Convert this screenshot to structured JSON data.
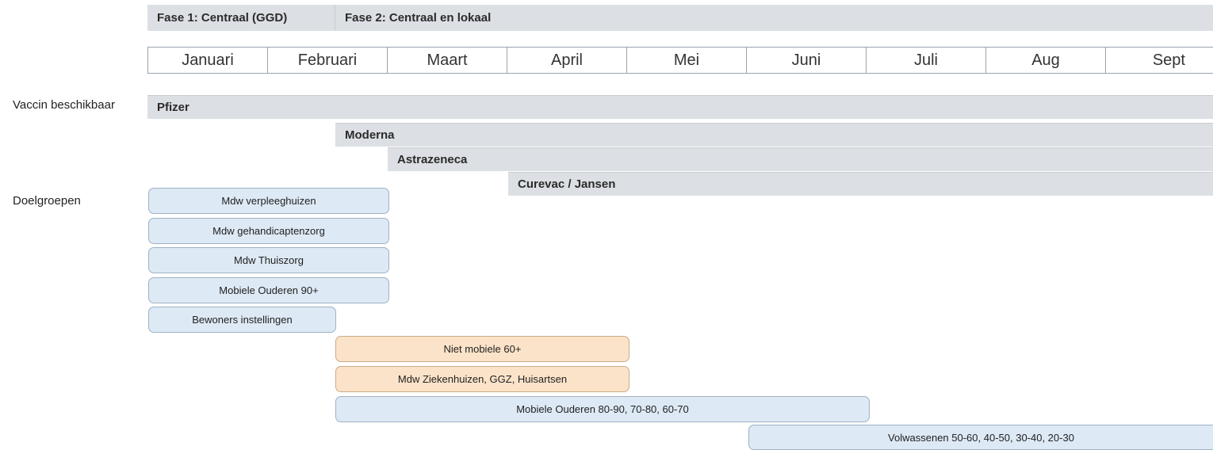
{
  "phases": [
    {
      "label": "Fase 1: Centraal (GGD)"
    },
    {
      "label": "Fase 2: Centraal en lokaal"
    }
  ],
  "months": [
    "Januari",
    "Februari",
    "Maart",
    "April",
    "Mei",
    "Juni",
    "Juli",
    "Aug",
    "Sept"
  ],
  "row_labels": {
    "vaccines": "Vaccin beschikbaar",
    "groups": "Doelgroepen"
  },
  "vaccines": [
    {
      "name": "Pfizer",
      "start_month": "Januari"
    },
    {
      "name": "Moderna",
      "start_month": "Februari"
    },
    {
      "name": "Astrazeneca",
      "start_month": "Maart"
    },
    {
      "name": "Curevac / Jansen",
      "start_month": "April"
    }
  ],
  "groups": [
    {
      "label": "Mdw verpleeghuizen",
      "color": "#dde9f5"
    },
    {
      "label": "Mdw gehandicaptenzorg",
      "color": "#dde9f5"
    },
    {
      "label": "Mdw Thuiszorg",
      "color": "#dde9f5"
    },
    {
      "label": "Mobiele Ouderen 90+",
      "color": "#dde9f5"
    },
    {
      "label": "Bewoners instellingen",
      "color": "#dde9f5"
    },
    {
      "label": "Niet mobiele 60+",
      "color": "#fbe3c9"
    },
    {
      "label": "Mdw Ziekenhuizen, GGZ, Huisartsen",
      "color": "#fbe3c9"
    },
    {
      "label": "Mobiele Ouderen 80-90, 70-80, 60-70",
      "color": "#dde9f5"
    },
    {
      "label": "Volwassenen 50-60, 40-50, 30-40, 20-30",
      "color": "#dde9f5"
    }
  ]
}
